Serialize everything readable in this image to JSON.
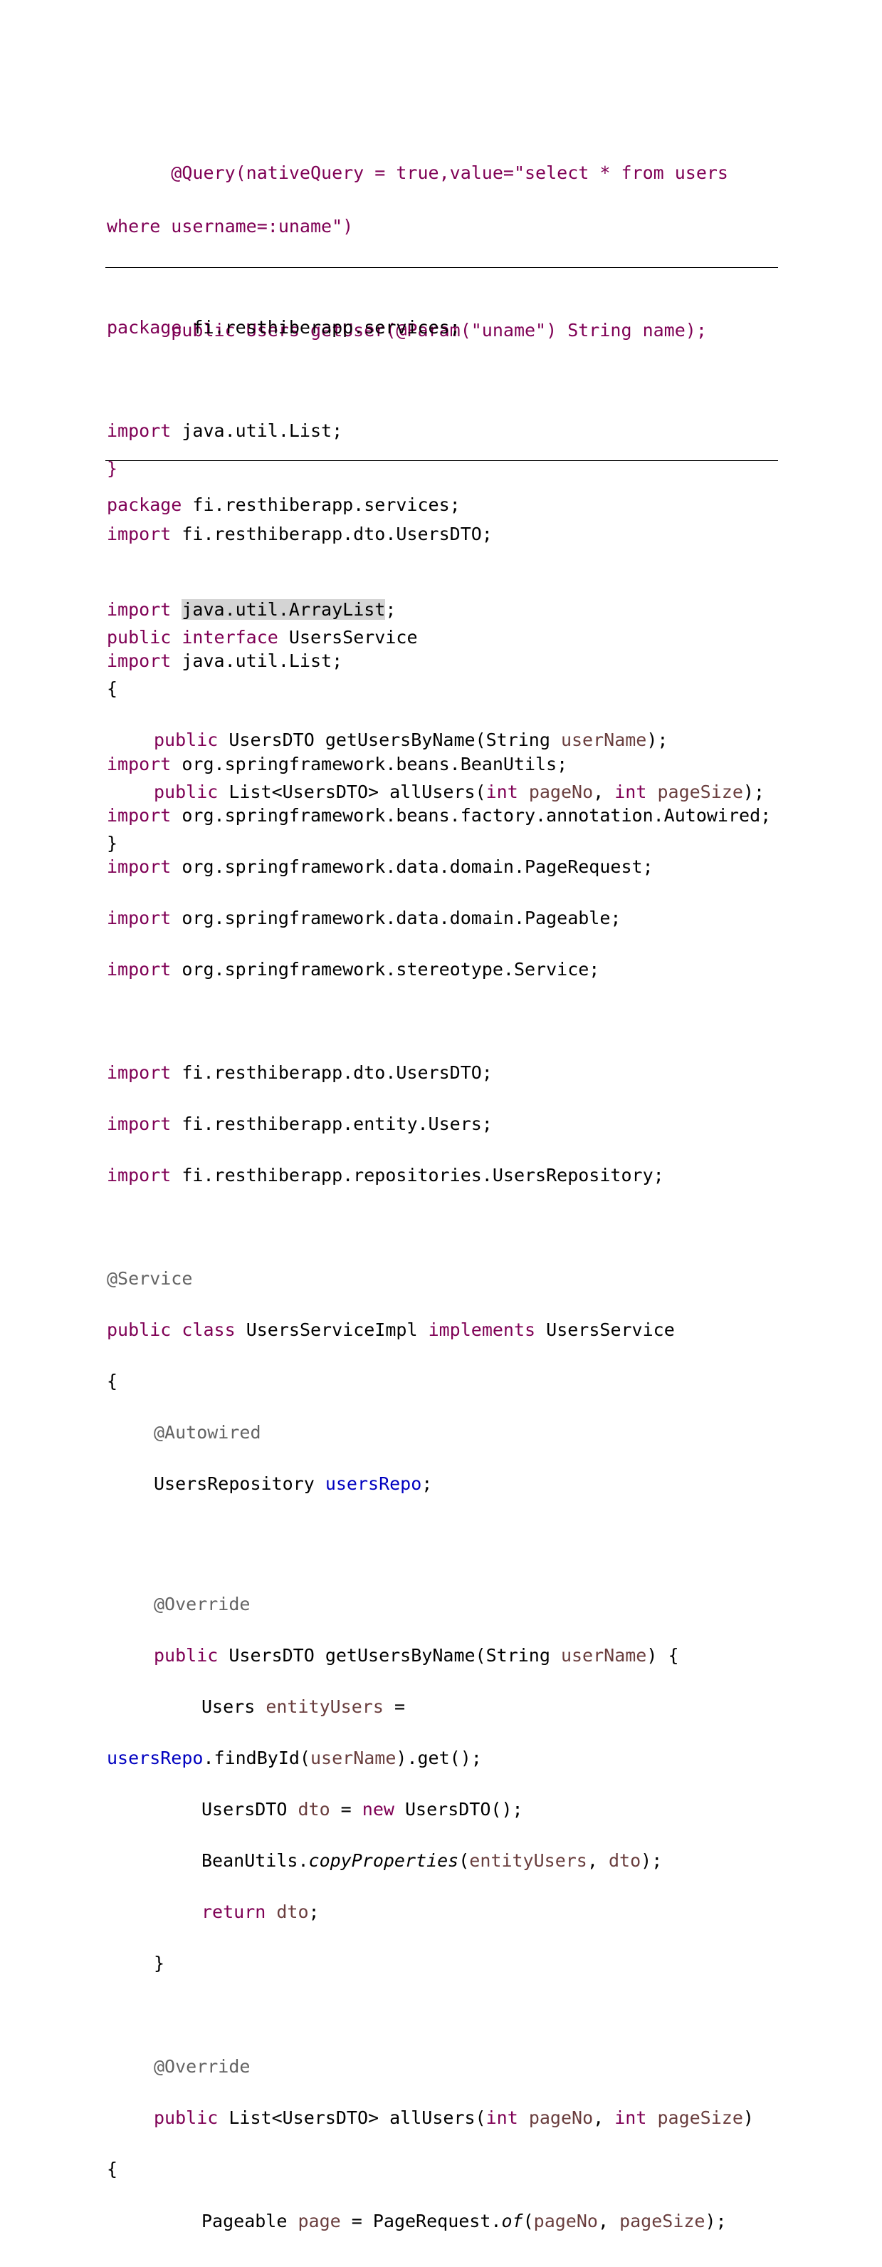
{
  "snippet1": {
    "query_line1": "\t@Query(nativeQuery = true,value=\"select * from users",
    "query_line2": "where username=:uname\")",
    "method_public": "\tpublic Users getUser(@Param(\"uname\") String name);",
    "close_brace": "}"
  },
  "snippet2": {
    "kw_package": "package",
    "package_name": " fi.resthiberapp.services;",
    "kw_import": "import",
    "import_list": " java.util.List;",
    "import_dto": " fi.resthiberapp.dto.UsersDTO;",
    "kw_public": "public",
    "kw_interface": "interface",
    "interface_name": " UsersService",
    "open_brace": "{",
    "m1_ret": " UsersDTO getUsersByName(String ",
    "m1_param": "userName",
    "m1_end": ");",
    "m2_ret": " List<UsersDTO> allUsers(",
    "kw_int": "int",
    "p_pageNo": "pageNo",
    "p_pageSize": "pageSize",
    "comma": ", ",
    "m2_end": ");",
    "close_brace": "}"
  },
  "snippet3": {
    "package_name": " fi.resthiberapp.services;",
    "imports_java": [
      "java.util.ArrayList",
      " java.util.List;"
    ],
    "imports_spring": [
      " org.springframework.beans.BeanUtils;",
      " org.springframework.beans.factory.annotation.Autowired;",
      " org.springframework.data.domain.PageRequest;",
      " org.springframework.data.domain.Pageable;",
      " org.springframework.stereotype.Service;"
    ],
    "imports_app": [
      " fi.resthiberapp.dto.UsersDTO;",
      " fi.resthiberapp.entity.Users;",
      " fi.resthiberapp.repositories.UsersRepository;"
    ],
    "ann_service": "@Service",
    "kw_class": "class",
    "class_name": " UsersServiceImpl ",
    "kw_implements": "implements",
    "implements_name": " UsersService",
    "ann_autowired": "@Autowired",
    "repo_type": "UsersRepository ",
    "repo_field": "usersRepo",
    "semicolon": ";",
    "ann_override": "@Override",
    "m1_open": ") {",
    "users_type": "Users ",
    "entity_var": "entityUsers",
    "assign": " =",
    "find_call": ".findById(",
    "find_end": ").get();",
    "dto_type": "UsersDTO ",
    "dto_var": "dto",
    "eq": " = ",
    "kw_new": "new",
    "new_dto": " UsersDTO();",
    "bean_utils": "BeanUtils.",
    "copy_props": "copyProperties",
    "paren_open": "(",
    "paren_close_semi": ");",
    "kw_return": "return",
    "ret_end": ";",
    "close_inner": "}",
    "m2_close_paren": ")",
    "open_brace": "{",
    "pageable_type": "Pageable ",
    "page_var": "page",
    "page_request": "PageRequest.",
    "method_of": "of"
  }
}
